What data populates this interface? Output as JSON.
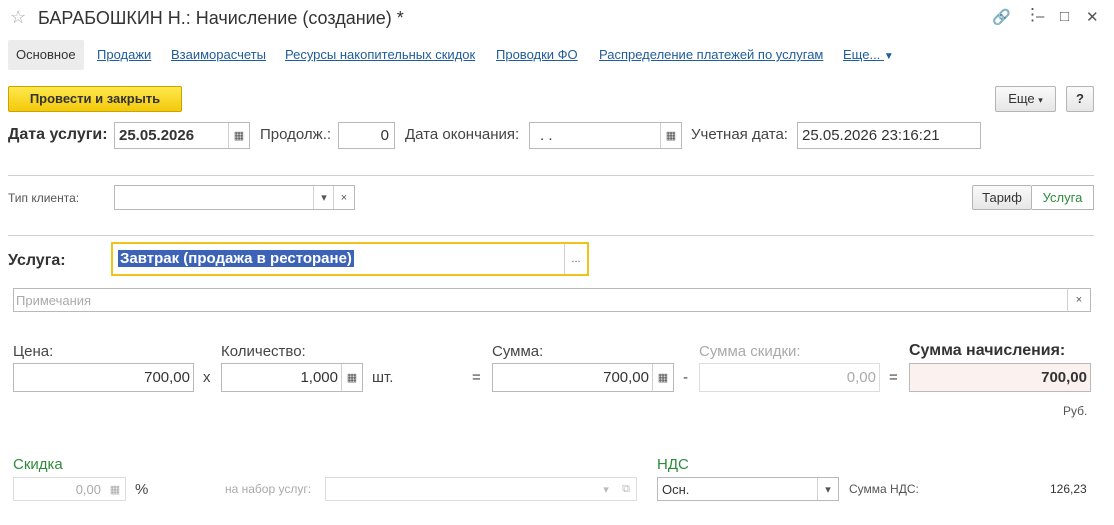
{
  "window": {
    "title": "БАРАБОШКИН Н.: Начисление (создание) *"
  },
  "tabs": [
    "Основное",
    "Продажи",
    "Взаиморасчеты",
    "Ресурсы накопительных скидок",
    "Проводки ФО",
    "Распределение платежей по услугам",
    "Еще..."
  ],
  "toolbar": {
    "post_close": "Провести и закрыть",
    "more": "Еще",
    "help": "?"
  },
  "dates": {
    "service_date_label": "Дата услуги:",
    "service_date": "25.05.2026",
    "duration_label": "Продолж.:",
    "duration": "0",
    "end_date_label": "Дата окончания:",
    "end_date": ".  .",
    "account_date_label": "Учетная дата:",
    "account_date": "25.05.2026 23:16:21"
  },
  "client": {
    "type_label": "Тип клиента:",
    "type_value": "",
    "tariff": "Тариф",
    "service": "Услуга"
  },
  "service": {
    "label": "Услуга:",
    "value": "Завтрак (продажа в ресторане)",
    "notes_placeholder": "Примечания"
  },
  "amounts": {
    "price_label": "Цена:",
    "price": "700,00",
    "qty_label": "Количество:",
    "qty": "1,000",
    "unit": "шт.",
    "sum_label": "Сумма:",
    "sum": "700,00",
    "discount_sum_label": "Сумма скидки:",
    "discount_sum": "0,00",
    "total_label": "Сумма начисления:",
    "total": "700,00",
    "currency": "Руб.",
    "x": "x",
    "eq": "=",
    "minus": "-"
  },
  "discount": {
    "label": "Скидка",
    "value": "0,00",
    "percent": "%",
    "set_label": "на набор услуг:"
  },
  "vat": {
    "label": "НДС",
    "value": "Осн.",
    "sum_label": "Сумма НДС:",
    "sum": "126,23"
  },
  "colors": {
    "accent_yellow": "#f3c90b",
    "link": "#1f5c99",
    "green": "#2e8b3a",
    "selection": "#3d63b8"
  }
}
